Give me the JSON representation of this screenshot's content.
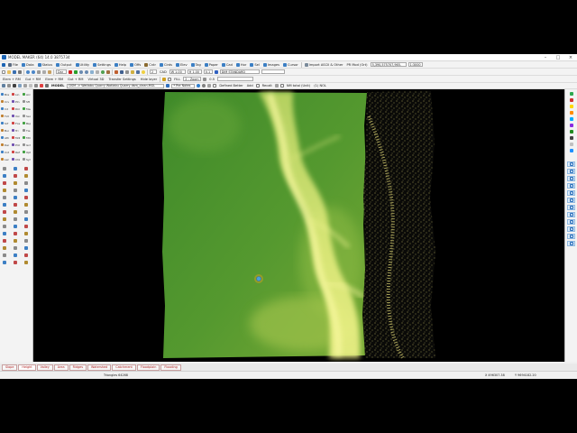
{
  "window": {
    "title": "MODEL MAKER (64) 14.0  3875734"
  },
  "menu": [
    {
      "label": "File",
      "color": "#5a6a80"
    },
    {
      "label": "Data",
      "color": "#3c7fc4"
    },
    {
      "label": "Status",
      "color": "#3c7fc4"
    },
    {
      "label": "Output",
      "color": "#3c7fc4"
    },
    {
      "label": "Utility",
      "color": "#3c7fc4"
    },
    {
      "label": "Settings",
      "color": "#3c7fc4"
    },
    {
      "label": "Help",
      "color": "#3c7fc4"
    },
    {
      "label": "Offs",
      "color": "#3c7fc4"
    },
    {
      "label": "Cntr",
      "color": "#8a6a30"
    },
    {
      "label": "Cirds",
      "color": "#3c7fc4"
    },
    {
      "label": "Elev",
      "color": "#3c7fc4"
    },
    {
      "label": "Tag",
      "color": "#3c7fc4"
    },
    {
      "label": "Paper",
      "color": "#3c7fc4"
    },
    {
      "label": "Cad",
      "color": "#3c7fc4"
    },
    {
      "label": "Hor",
      "color": "#3c7fc4"
    },
    {
      "label": "Sel",
      "color": "#3c7fc4"
    },
    {
      "label": "Images",
      "color": "#3c7fc4"
    },
    {
      "label": "Cursor",
      "color": "#3c7fc4"
    }
  ],
  "toolbar1_right": {
    "import_label": "Import ASCII & Other",
    "coords_label": "PR Mod (Ort)",
    "coords_value": "5,390,575707,965.",
    "scale_value": "1:3000"
  },
  "toolbar2": {
    "layer_field": "Dar",
    "z_field": "2",
    "cad_label": "CAD",
    "grid_value": "W 1.00",
    "hstep_value": "H 1.00",
    "dash_value": "0.1",
    "style_field": "DIM STANDARD",
    "aux_field": ""
  },
  "toolbar3": {
    "items": [
      "Elem + RM",
      "Gut + RM",
      "Elem + RM",
      "Gut + RM",
      "Virtual 3D",
      "Transfer Settings",
      "Hide layer"
    ],
    "fill_label": "FILL",
    "zoom_field": "2 - Zoom",
    "smooth_label": "0.5"
  },
  "toolbar4": {
    "model_label": "MODEL",
    "dsm_path": "DSM ->  Watlabu Quarry Watlabu Quarry dsm_clean.MGL",
    "notes_field": "* Pre Notes",
    "defined_label": "Defined Better",
    "add_label": "Add",
    "recalc_label": "Recalt",
    "nm_label": "NM total (Unit)",
    "pct_label": "(1) NOL"
  },
  "left_tools": [
    "Bra",
    "Lin",
    "Arc",
    "Crv",
    "Pln",
    "Sft",
    "Cd",
    "Dim",
    "Mea",
    "Txt",
    "Vol",
    "Sec",
    "Srf",
    "Fce",
    "Bsp",
    "Bur",
    "Tri",
    "Tie",
    "Ath",
    "Mdl",
    "Mtr",
    "Dem",
    "Pnt",
    "Grd",
    "Cnt",
    "Ref",
    "Opt",
    "Len",
    "Chk",
    "Sym"
  ],
  "right_colors": [
    "#2ea84f",
    "#d03030",
    "#ffd800",
    "#ff8c00",
    "#00aaff",
    "#8a2be2",
    "#228b22",
    "#444444",
    "#c0c0c0",
    "#1e90ff"
  ],
  "tabs": [
    "Slope",
    "Height",
    "Valley",
    "Area",
    "Ridges",
    "Watershed",
    "Catchment",
    "Floodplain",
    "Flooding"
  ],
  "active_tab": "Height",
  "status": {
    "left": "Triangles 64268",
    "x": "X 496307.38",
    "y": "Y 9694182.20"
  },
  "colors": {
    "terrain_low": "#3f8a2a",
    "terrain_mid": "#9cc24a",
    "terrain_high": "#f4f48a",
    "points": "#c8c06a",
    "marker": "#4a9fd8"
  }
}
